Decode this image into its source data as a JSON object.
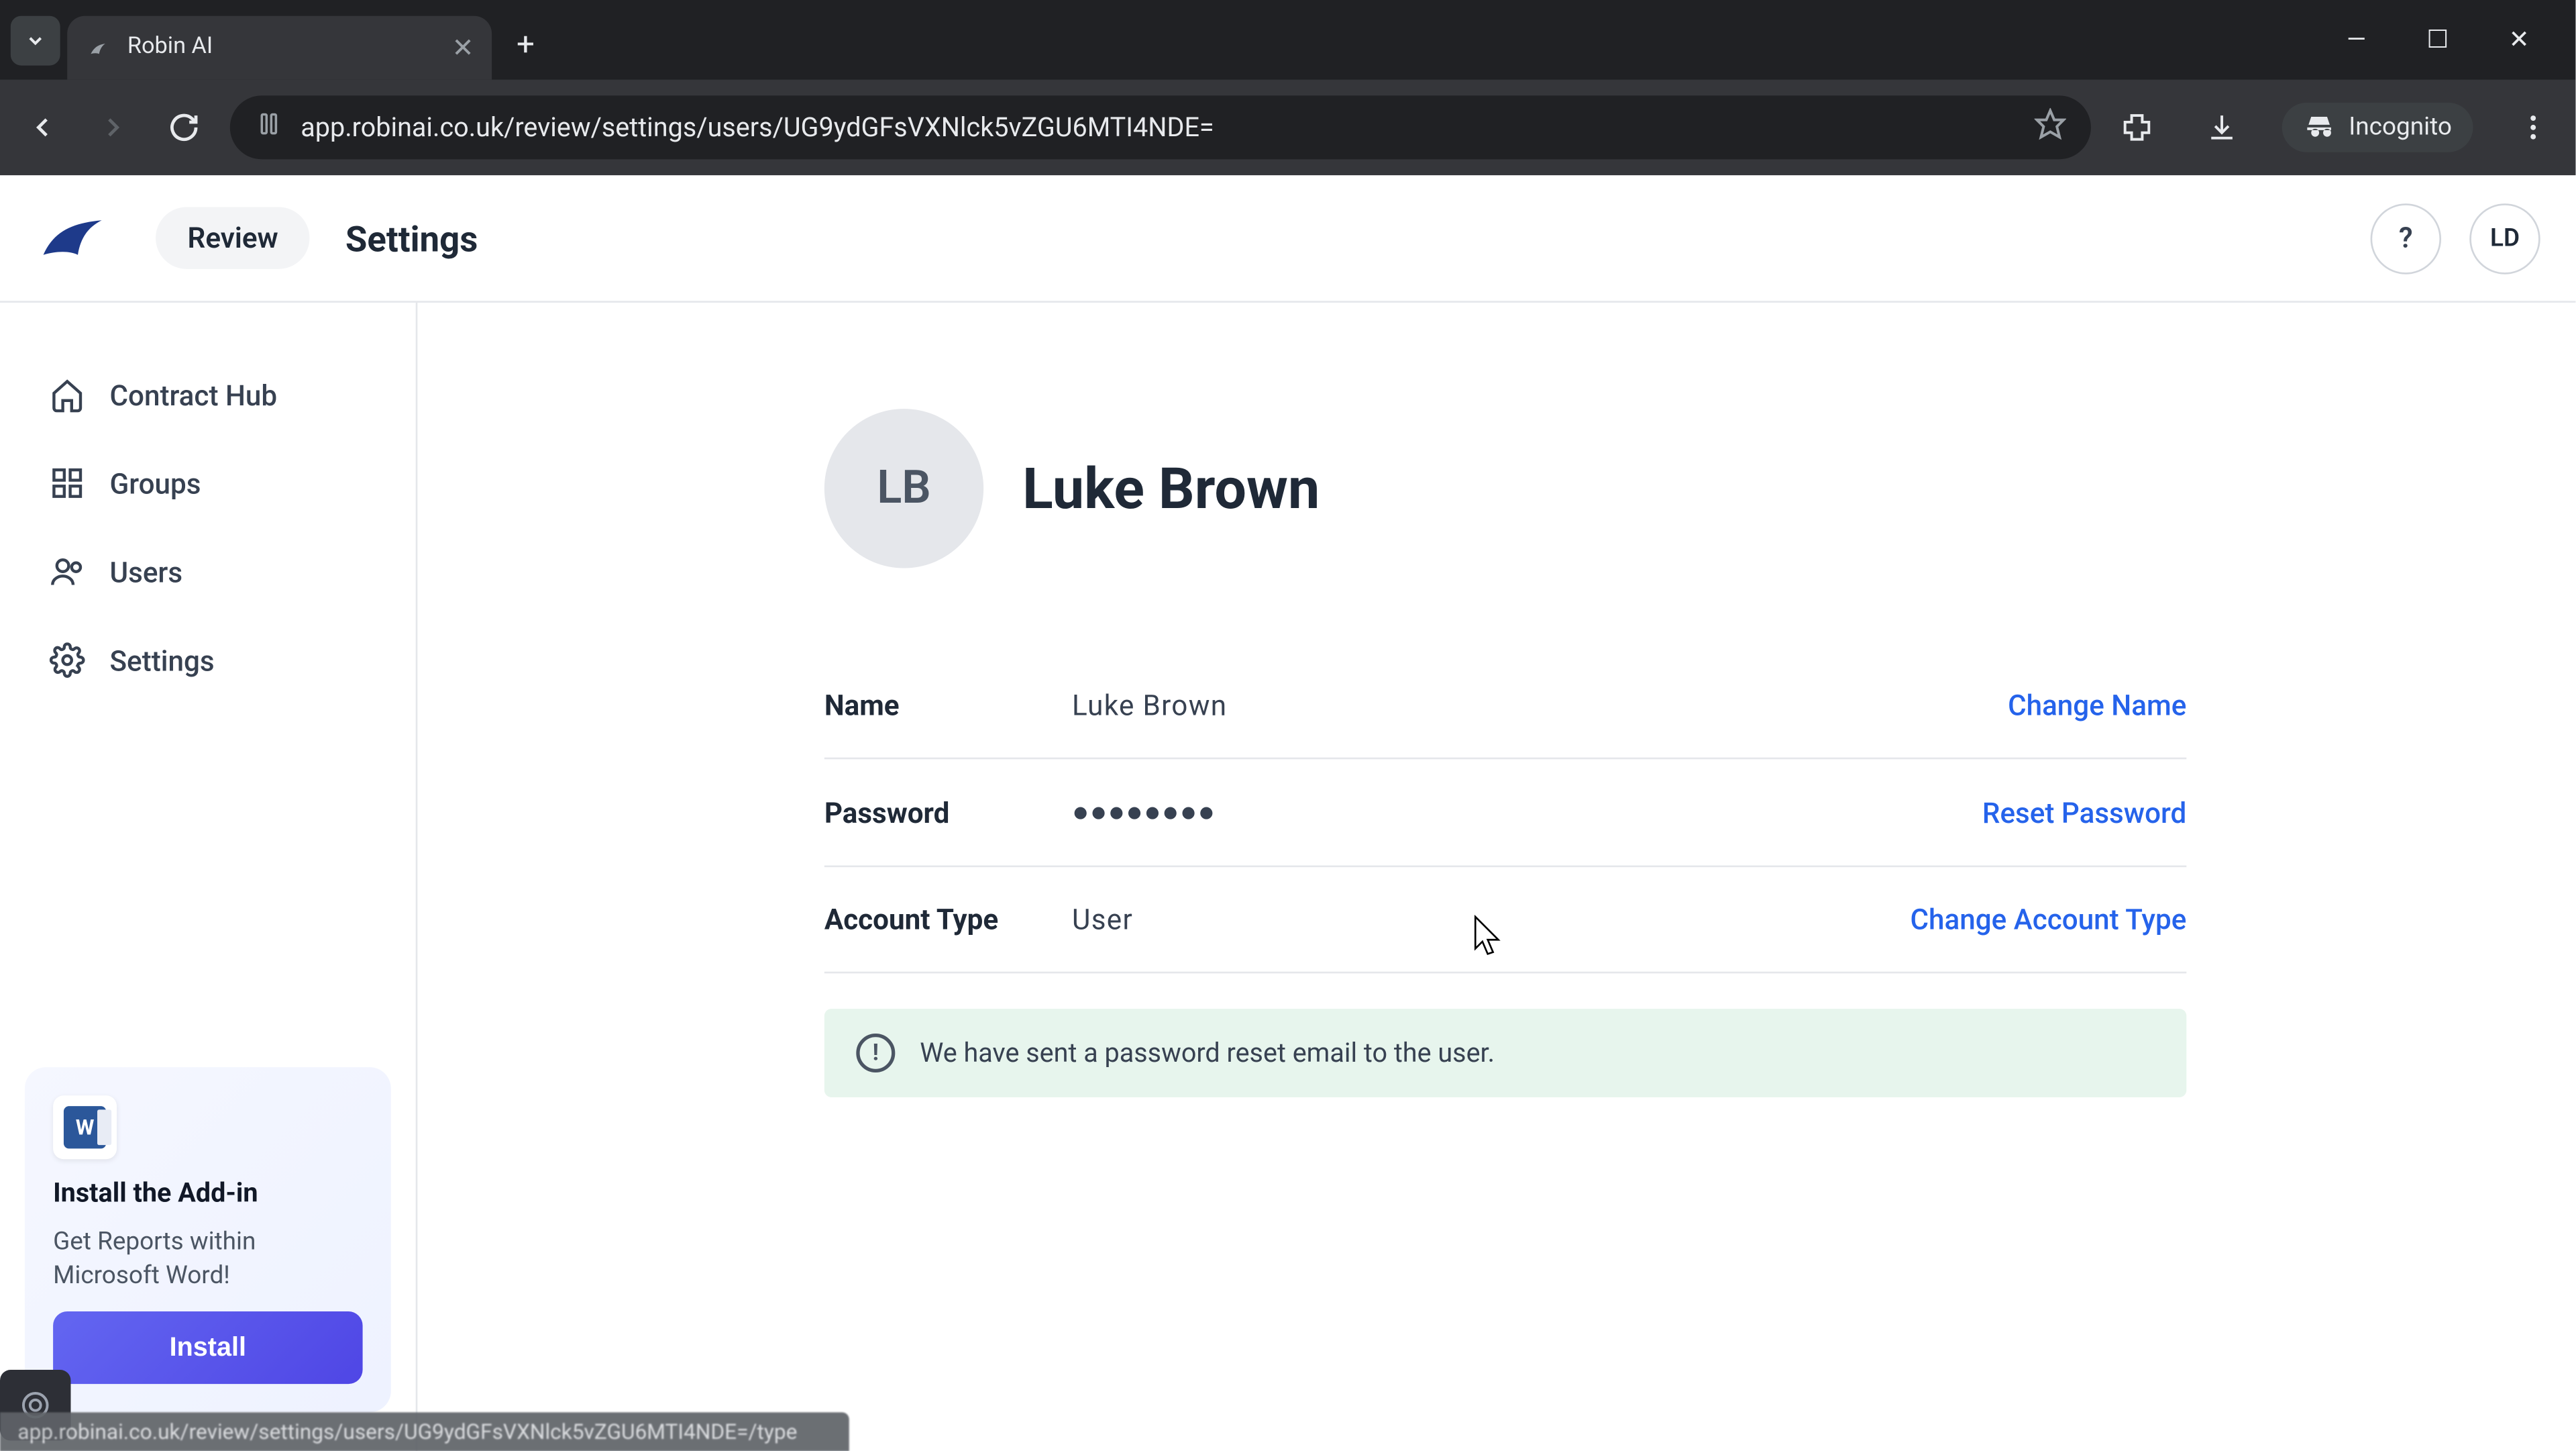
{
  "browser": {
    "tab_title": "Robin AI",
    "url": "app.robinai.co.uk/review/settings/users/UG9ydGFsVXNlck5vZGU6MTI4NDE=",
    "incognito_label": "Incognito",
    "new_tab_glyph": "+",
    "min_glyph": "—",
    "max_glyph": "☐",
    "close_glyph": "✕"
  },
  "header": {
    "review_label": "Review",
    "page_title": "Settings",
    "help_glyph": "?",
    "user_initials": "LD"
  },
  "sidebar": {
    "items": [
      {
        "label": "Contract Hub"
      },
      {
        "label": "Groups"
      },
      {
        "label": "Users"
      },
      {
        "label": "Settings"
      }
    ],
    "addin": {
      "title": "Install the Add-in",
      "subtitle": "Get Reports within Microsoft Word!",
      "button": "Install",
      "word_glyph": "W"
    }
  },
  "profile": {
    "avatar_initials": "LB",
    "full_name": "Luke Brown",
    "rows": {
      "name": {
        "label": "Name",
        "value": "Luke Brown",
        "action": "Change Name"
      },
      "password": {
        "label": "Password",
        "value": "●●●●●●●●",
        "action": "Reset Password"
      },
      "account_type": {
        "label": "Account Type",
        "value": "User",
        "action": "Change Account Type"
      }
    },
    "alert": {
      "icon_glyph": "!",
      "message": "We have sent a password reset email to the user."
    }
  },
  "status_link": "app.robinai.co.uk/review/settings/users/UG9ydGFsVXNlck5vZGU6MTI4NDE=/type"
}
